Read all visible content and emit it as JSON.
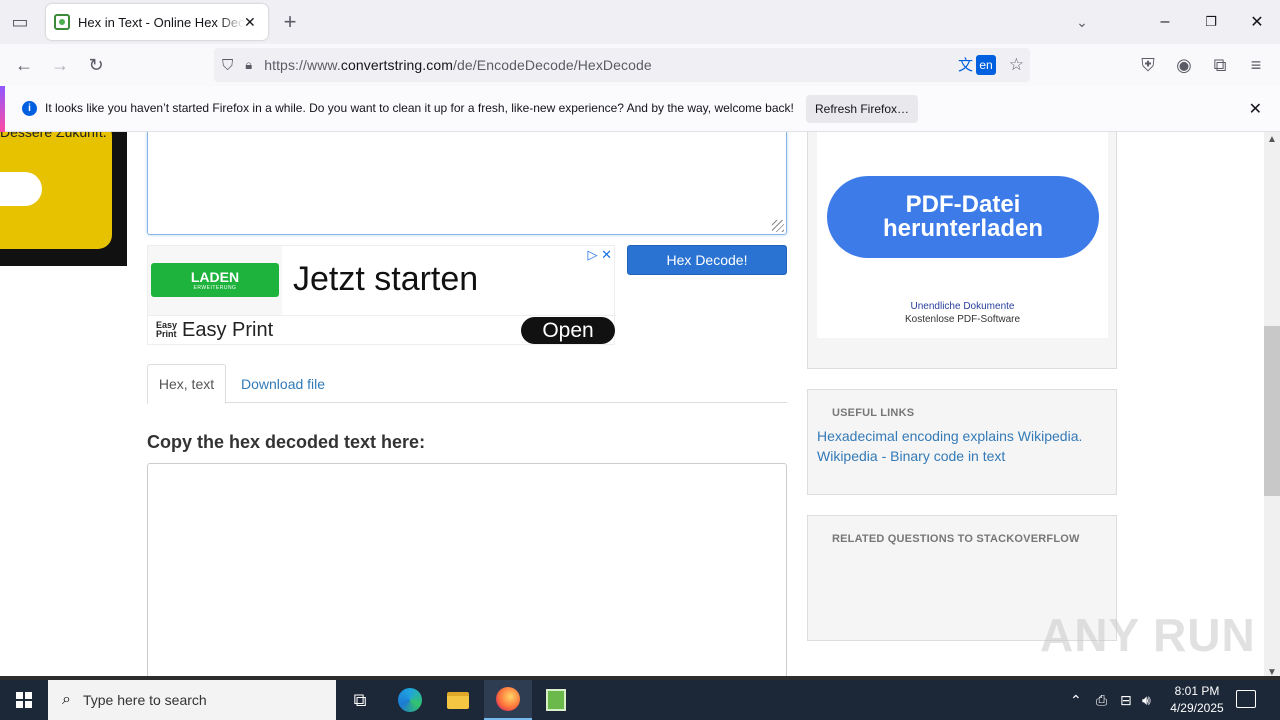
{
  "browser": {
    "tab_title": "Hex in Text - Online Hex Decoder",
    "url_prefix": "https://www.",
    "url_domain": "convertstring.com",
    "url_path": "/de/EncodeDecode/HexDecode",
    "translate_lang": "en"
  },
  "notification": {
    "message": "It looks like you haven’t started Firefox in a while. Do you want to clean it up for a fresh, like-new experience? And by the way, welcome back!",
    "button": "Refresh Firefox…"
  },
  "left_image": {
    "text": "Dessere Zukunft."
  },
  "ad": {
    "laden_label": "LADEN",
    "laden_sub": "ERWEITERUNG",
    "headline": "Jetzt starten",
    "brand_logo": "Easy Print",
    "brand": "Easy Print",
    "open_label": "Open"
  },
  "main": {
    "decode_button": "Hex Decode!",
    "tabs": [
      {
        "label": "Hex, text"
      },
      {
        "label": "Download file"
      }
    ],
    "output_heading": "Copy the hex decoded text here:"
  },
  "sidebar": {
    "pdf_ad": {
      "button": "PDF-Datei herunterladen",
      "line1": "Unendliche Dokumente",
      "line2": "Kostenlose PDF-Software"
    },
    "useful_links_title": "USEFUL LINKS",
    "useful_links": [
      "Hexadecimal encoding explains Wikipedia.",
      "Wikipedia - Binary code in text"
    ],
    "related_title": "RELATED QUESTIONS TO STACKOVERFLOW"
  },
  "watermark": "ANY RUN",
  "taskbar": {
    "search_placeholder": "Type here to search",
    "time": "8:01 PM",
    "date": "4/29/2025"
  }
}
